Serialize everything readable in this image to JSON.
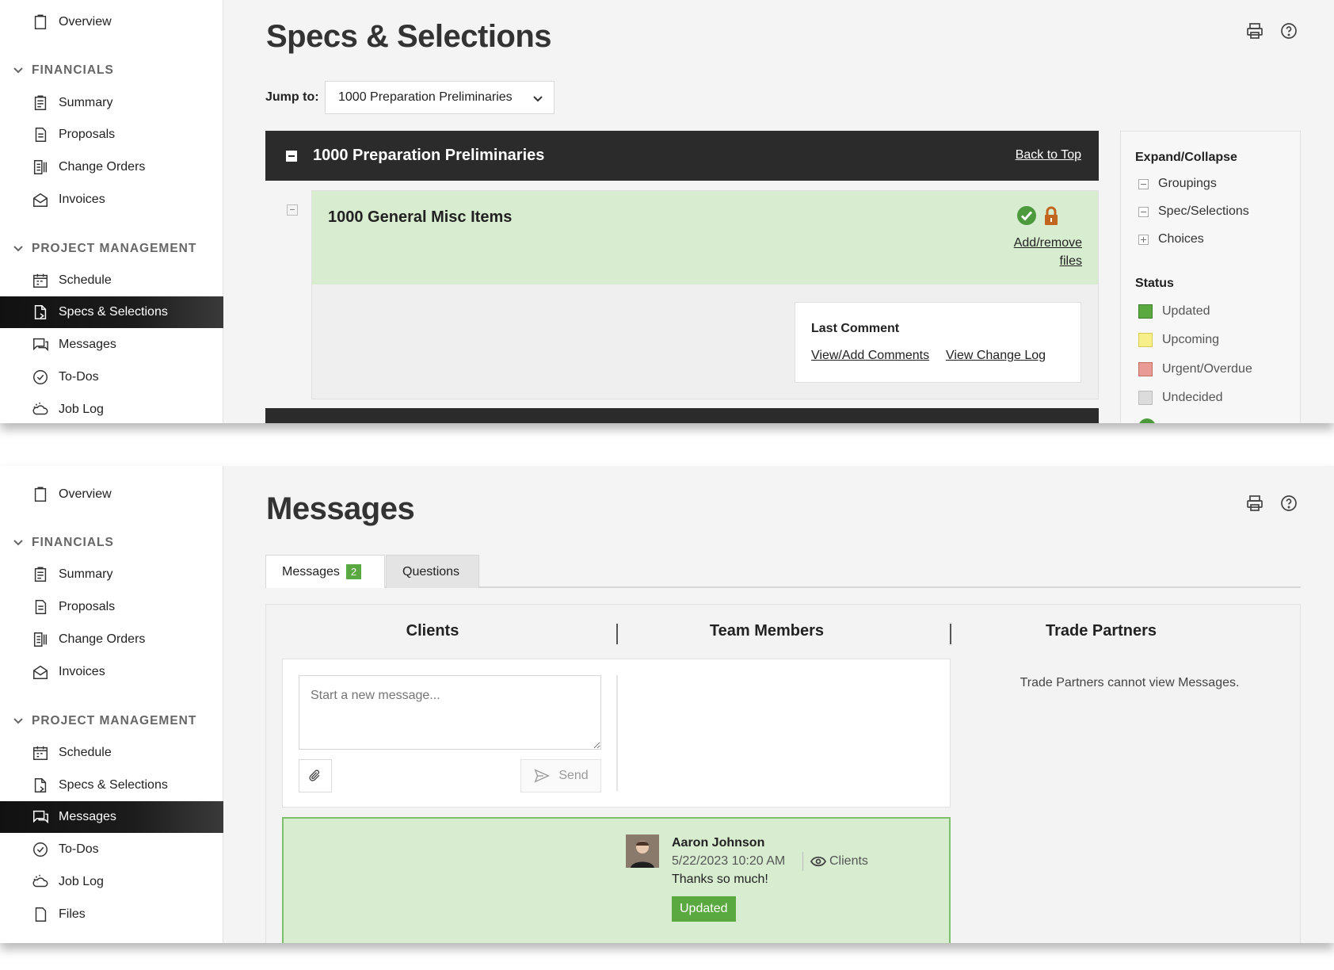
{
  "specs_view": {
    "sidebar": {
      "overview": "Overview",
      "financials_heading": "FINANCIALS",
      "summary": "Summary",
      "proposals": "Proposals",
      "change_orders": "Change Orders",
      "invoices": "Invoices",
      "pm_heading": "PROJECT MANAGEMENT",
      "schedule": "Schedule",
      "specs": "Specs & Selections",
      "messages": "Messages",
      "todos": "To-Dos",
      "job_log": "Job Log"
    },
    "page_title": "Specs & Selections",
    "jump_label": "Jump to:",
    "jump_value": "1000 Preparation Preliminaries",
    "group_title": "1000 Preparation Preliminaries",
    "back_to_top": "Back to Top",
    "item_title": "1000 General Misc Items",
    "add_remove_files": "Add/remove files",
    "last_comment": "Last Comment",
    "view_add_comments": "View/Add Comments",
    "view_change_log": "View Change Log",
    "side_panel": {
      "expand_heading": "Expand/Collapse",
      "groupings": "Groupings",
      "spec_selections": "Spec/Selections",
      "choices": "Choices",
      "status_heading": "Status",
      "updated": "Updated",
      "upcoming": "Upcoming",
      "urgent": "Urgent/Overdue",
      "undecided": "Undecided"
    },
    "colors": {
      "updated": "#5aa940",
      "upcoming": "#f7f08a",
      "urgent": "#e89a94",
      "undecided": "#dcdcdc",
      "item_head_bg": "#d8ecd0"
    }
  },
  "messages_view": {
    "sidebar": {
      "overview": "Overview",
      "financials_heading": "FINANCIALS",
      "summary": "Summary",
      "proposals": "Proposals",
      "change_orders": "Change Orders",
      "invoices": "Invoices",
      "pm_heading": "PROJECT MANAGEMENT",
      "schedule": "Schedule",
      "specs": "Specs & Selections",
      "messages": "Messages",
      "todos": "To-Dos",
      "job_log": "Job Log",
      "files": "Files"
    },
    "page_title": "Messages",
    "tabs": {
      "messages": "Messages",
      "messages_count": "2",
      "questions": "Questions"
    },
    "columns": {
      "clients": "Clients",
      "team_members": "Team Members",
      "trade_partners": "Trade Partners"
    },
    "compose_placeholder": "Start a new message...",
    "send_label": "Send",
    "trade_partners_note": "Trade Partners cannot view Messages.",
    "message": {
      "author": "Aaron Johnson",
      "date": "5/22/2023 10:20 AM",
      "visibility": "Clients",
      "text": "Thanks so much!",
      "status": "Updated"
    }
  }
}
